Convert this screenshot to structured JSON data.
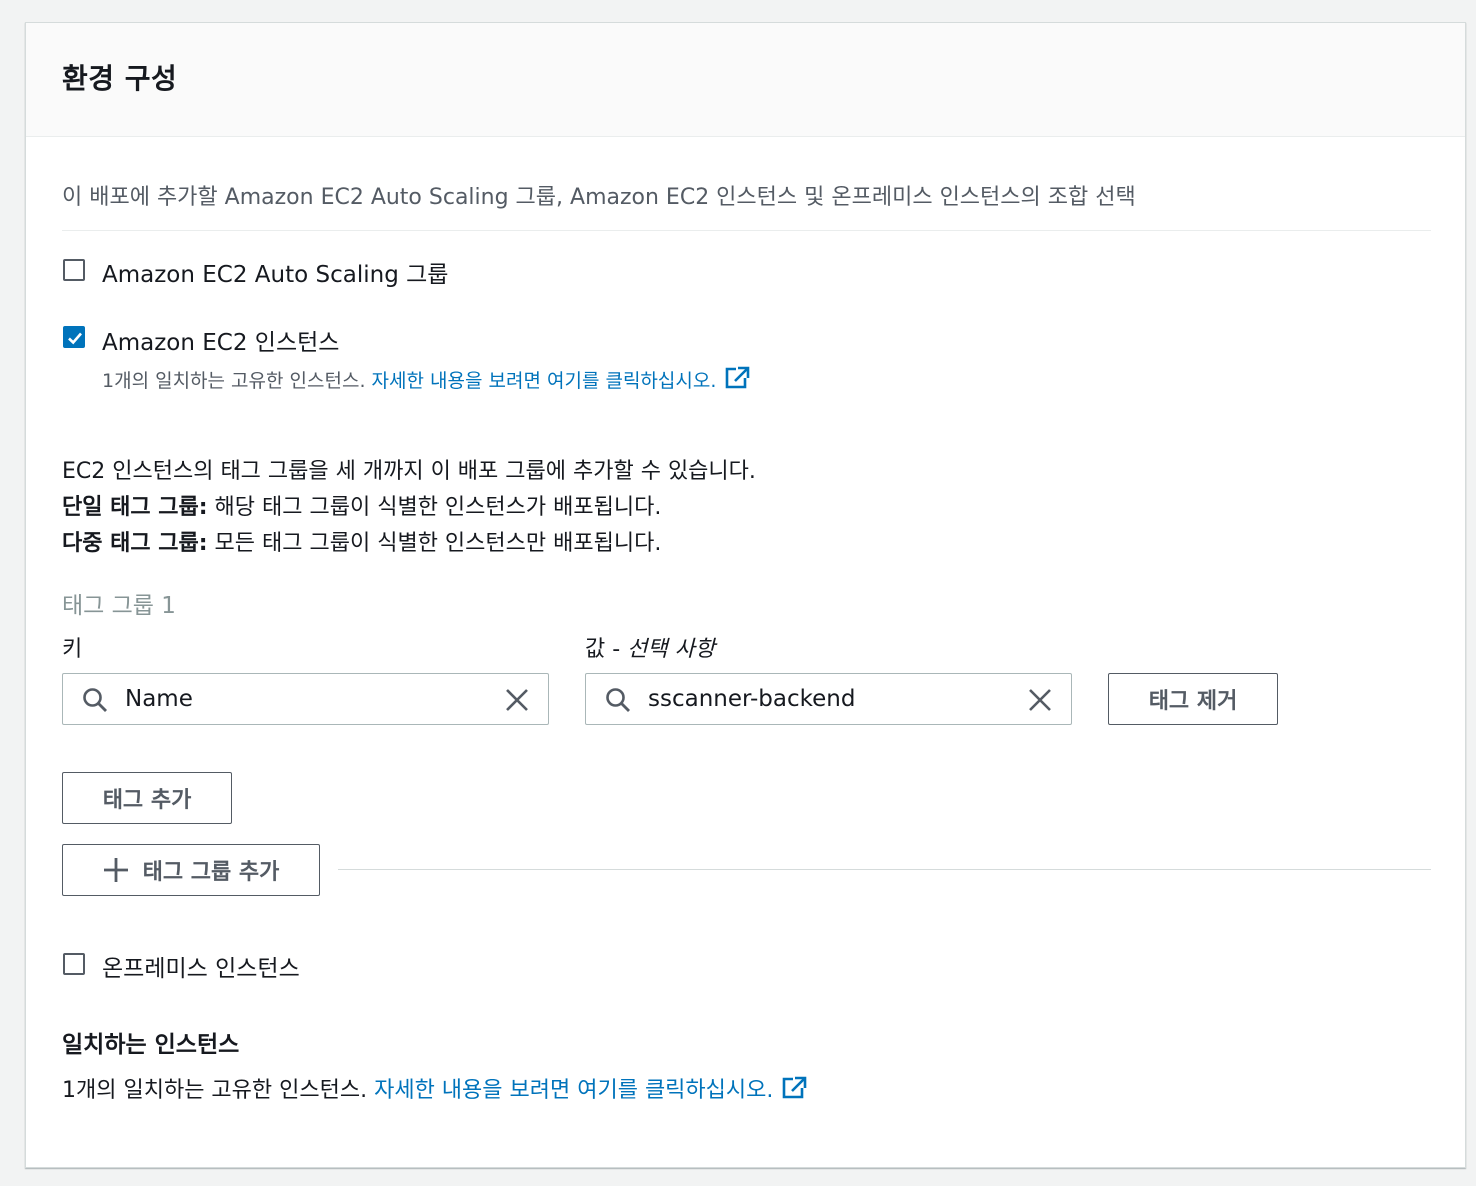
{
  "header": {
    "title": "환경 구성"
  },
  "description": "이 배포에 추가할 Amazon EC2 Auto Scaling 그룹, Amazon EC2 인스턴스 및 온프레미스 인스턴스의 조합 선택",
  "options": {
    "asg": {
      "label": "Amazon EC2 Auto Scaling 그룹",
      "checked": false
    },
    "ec2": {
      "label": "Amazon EC2 인스턴스",
      "checked": true,
      "match_text": "1개의 일치하는 고유한 인스턴스.",
      "match_link": "자세한 내용을 보려면 여기를 클릭하십시오."
    },
    "onprem": {
      "label": "온프레미스 인스턴스",
      "checked": false
    }
  },
  "info": {
    "line1": "EC2 인스턴스의 태그 그룹을 세 개까지 이 배포 그룹에 추가할 수 있습니다.",
    "single_label": "단일 태그 그룹:",
    "single_text": " 해당 태그 그룹이 식별한 인스턴스가 배포됩니다.",
    "multi_label": "다중 태그 그룹:",
    "multi_text": " 모든 태그 그룹이 식별한 인스턴스만 배포됩니다."
  },
  "tag_group": {
    "title": "태그 그룹 1",
    "key_label": "키",
    "value_label_prefix": "값 - ",
    "value_label_optional": "선택 사항",
    "key_value": "Name",
    "value_value": "sscanner-backend",
    "remove_button": "태그 제거",
    "add_tag_button": "태그 추가"
  },
  "add_tag_group_button": "태그 그룹 추가",
  "matching": {
    "title": "일치하는 인스턴스",
    "text": "1개의 일치하는 고유한 인스턴스.",
    "link": "자세한 내용을 보려면 여기를 클릭하십시오."
  },
  "colors": {
    "accent": "#0073bb",
    "text": "#16191f",
    "muted": "#545b64"
  }
}
